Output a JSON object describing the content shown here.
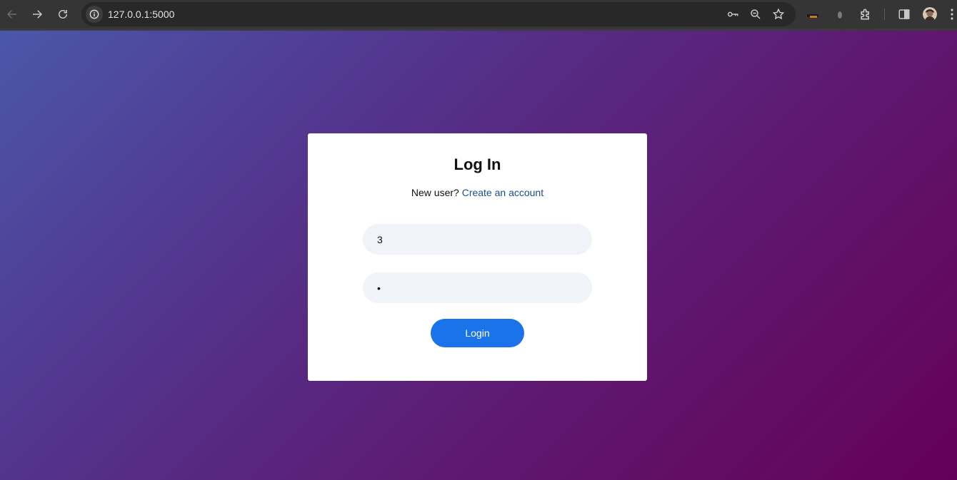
{
  "browser": {
    "url": "127.0.0.1:5000",
    "icons": [
      "back-arrow-icon",
      "forward-arrow-icon",
      "reload-icon",
      "site-info-icon",
      "password-key-icon",
      "zoom-icon",
      "bookmark-star-icon",
      "extension-icon",
      "extensions-puzzle-icon",
      "side-panel-icon",
      "profile-avatar",
      "menu-dots-icon"
    ]
  },
  "login": {
    "title": "Log In",
    "signup_prompt": "New user?",
    "signup_link": "Create an account",
    "username_value": "3",
    "password_value": "1",
    "button_label": "Login"
  },
  "colors": {
    "button": "#1a73e8",
    "link": "#1a4f8b",
    "gradient_start": "#4a57aa",
    "gradient_end": "#650058"
  }
}
